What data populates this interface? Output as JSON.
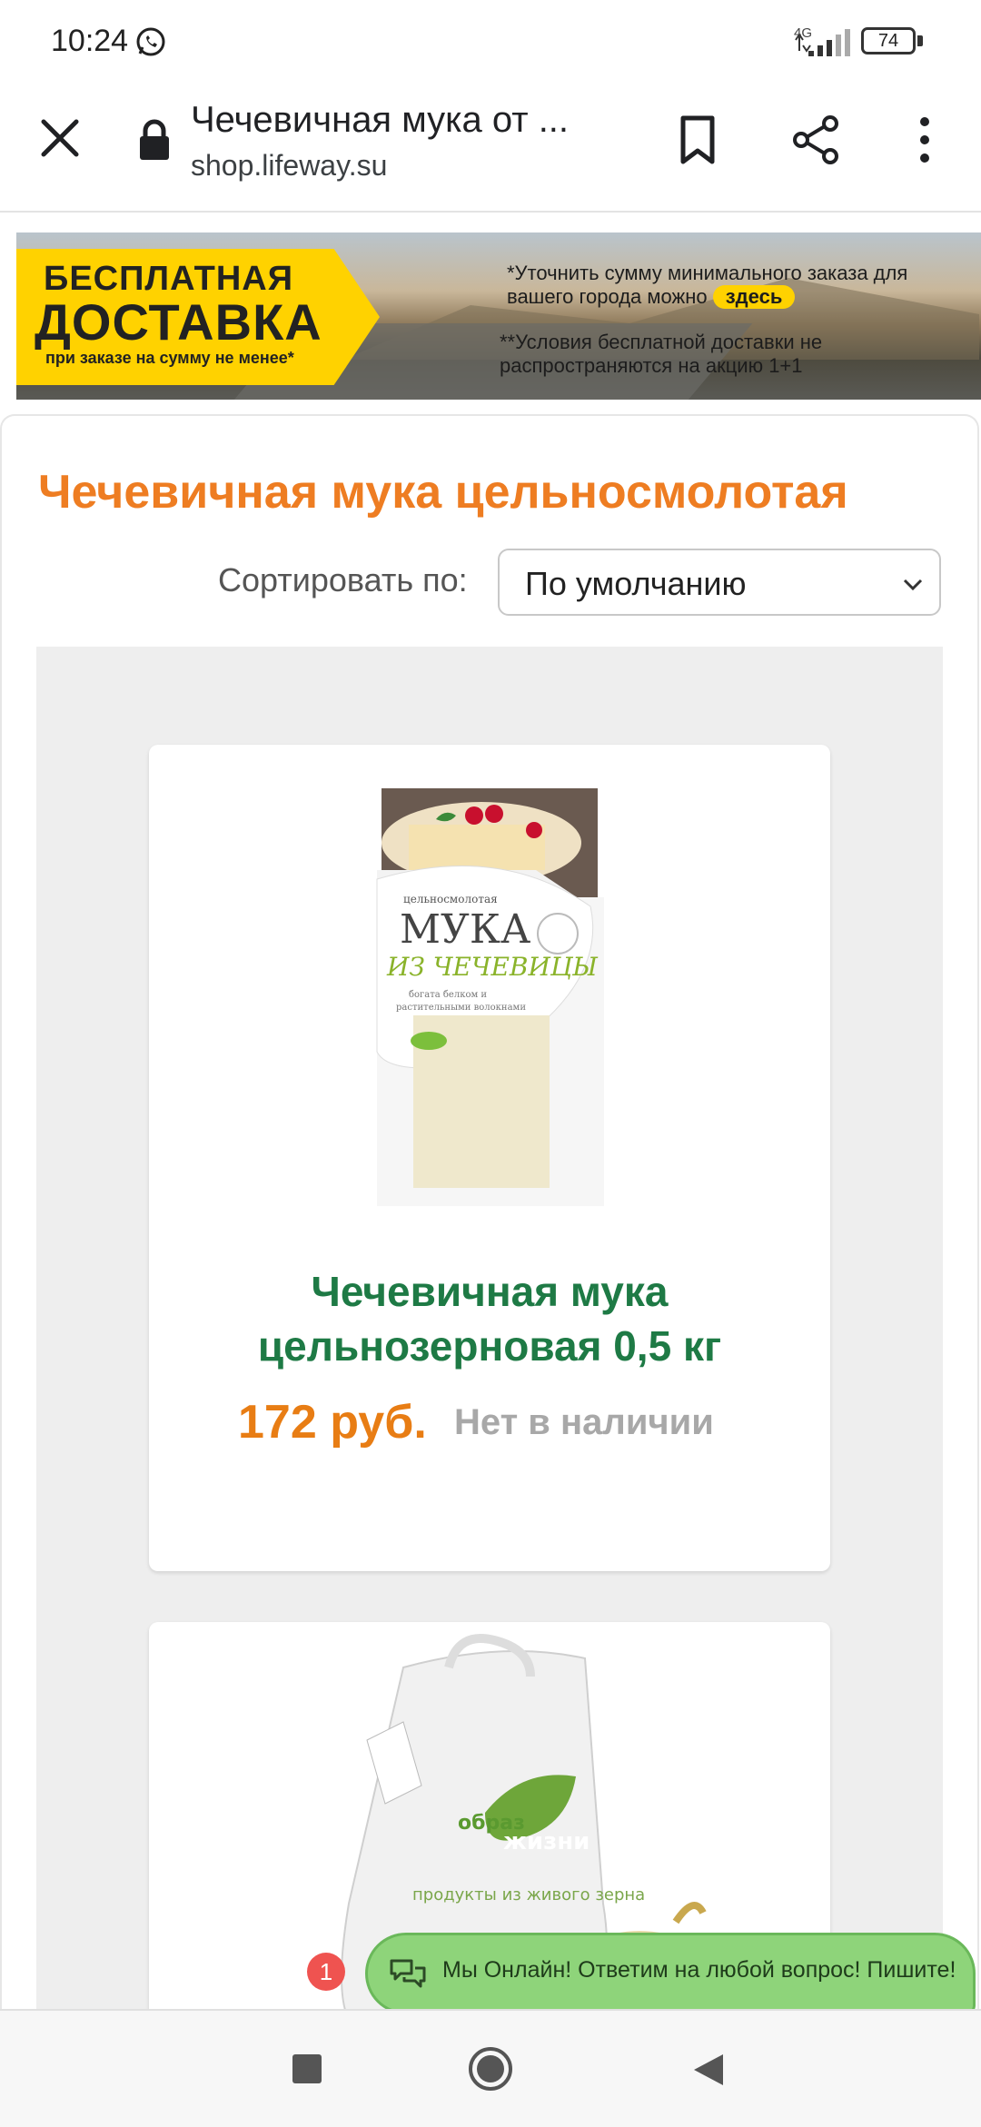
{
  "status_bar": {
    "time": "10:24",
    "network": "4G",
    "battery": "74"
  },
  "browser": {
    "page_title": "Чечевичная мука от ...",
    "url": "shop.lifeway.su"
  },
  "banner": {
    "line1": "БЕСПЛАТНАЯ",
    "line2": "ДОСТАВКА",
    "line3": "при заказе на сумму не менее*",
    "note1": "*Уточнить сумму минимального заказа для вашего города можно",
    "note1_link": "здесь",
    "note2": "**Условия бесплатной доставки не распространяются на акцию 1+1"
  },
  "category": {
    "title": "Чечевичная мука цельносмолотая",
    "sort_label": "Сортировать по:",
    "sort_value": "По умолчанию"
  },
  "products": [
    {
      "name": "Чечевичная мука цельнозерновая 0,5 кг",
      "price": "172 руб.",
      "stock": "Нет в наличии"
    }
  ],
  "chat": {
    "text": "Мы Онлайн! Ответим на любой вопрос! Пишите!",
    "badge": "1"
  },
  "colors": {
    "accent_orange": "#ee7d22",
    "product_green": "#1e7a45",
    "price_orange": "#e87d14",
    "chat_green": "#8ed47a",
    "banner_yellow": "#ffd200"
  }
}
